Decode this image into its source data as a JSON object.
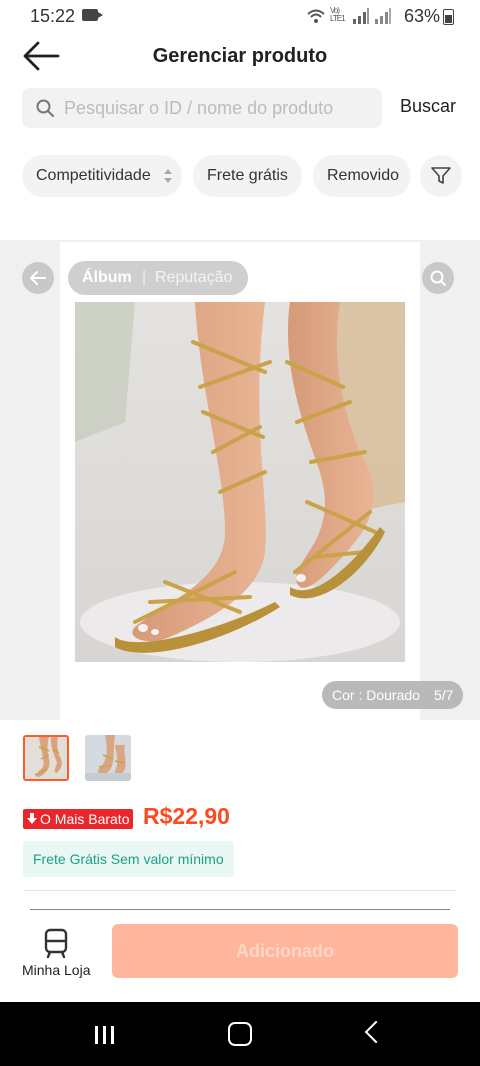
{
  "status_bar": {
    "time": "15:22",
    "network": "Vo) LTE1",
    "battery": "63%"
  },
  "header": {
    "title": "Gerenciar produto"
  },
  "search": {
    "placeholder": "Pesquisar o ID / nome do produto",
    "value": "",
    "button_label": "Buscar"
  },
  "filters": {
    "chips": [
      "Competitividade",
      "Frete grátis",
      "Removido"
    ]
  },
  "viewer": {
    "tabs": [
      "Álbum",
      "Reputação"
    ],
    "tab_separator": "|",
    "active_tab": "Álbum",
    "variant_label": "Cor : Dourado",
    "image_counter": "5/7"
  },
  "product": {
    "badge": "O Mais Barato",
    "price": "R$22,90",
    "shipping": "Frete Grátis Sem valor mínimo"
  },
  "bottom_bar": {
    "store_label": "Minha Loja",
    "action_label": "Adicionado"
  },
  "colors": {
    "accent": "#ff4a1f",
    "badge_red": "#e8262b",
    "shipping_green": "#1aa083",
    "button_disabled": "#ffb69c"
  }
}
